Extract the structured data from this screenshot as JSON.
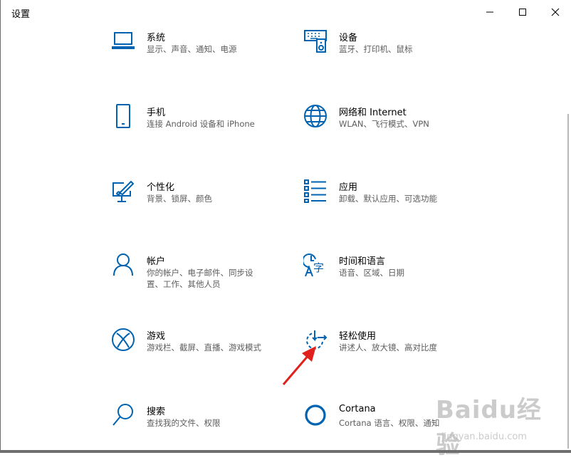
{
  "window": {
    "title": "设置",
    "controls": {
      "minimize": "minimize-icon",
      "maximize": "maximize-icon",
      "close": "close-icon"
    }
  },
  "tiles": [
    {
      "name": "系统",
      "desc": "显示、声音、通知、电源",
      "icon": "laptop-icon"
    },
    {
      "name": "设备",
      "desc": "蓝牙、打印机、鼠标",
      "icon": "keyboard-speaker-icon"
    },
    {
      "name": "手机",
      "desc": "连接 Android 设备和 iPhone",
      "icon": "phone-icon"
    },
    {
      "name": "网络和 Internet",
      "desc": "WLAN、飞行模式、VPN",
      "icon": "globe-icon"
    },
    {
      "name": "个性化",
      "desc": "背景、锁屏、颜色",
      "icon": "paint-brush-icon"
    },
    {
      "name": "应用",
      "desc": "卸载、默认应用、可选功能",
      "icon": "app-list-icon"
    },
    {
      "name": "帐户",
      "desc": "你的帐户、电子邮件、同步设置、工作、其他人员",
      "icon": "person-icon"
    },
    {
      "name": "时间和语言",
      "desc": "语音、区域、日期",
      "icon": "time-language-icon"
    },
    {
      "name": "游戏",
      "desc": "游戏栏、截屏、直播、游戏模式",
      "icon": "xbox-icon"
    },
    {
      "name": "轻松使用",
      "desc": "讲述人、放大镜、高对比度",
      "icon": "ease-of-access-icon"
    },
    {
      "name": "搜索",
      "desc": "查找我的文件、权限",
      "icon": "search-icon"
    },
    {
      "name": "Cortana",
      "desc": "Cortana 语言、权限、通知",
      "icon": "cortana-icon"
    }
  ],
  "watermark": {
    "brand": "Baidu经验",
    "url": "jingyan.baidu.com"
  },
  "colors": {
    "accent": "#0063b1",
    "annotation_arrow": "#e0201c"
  }
}
